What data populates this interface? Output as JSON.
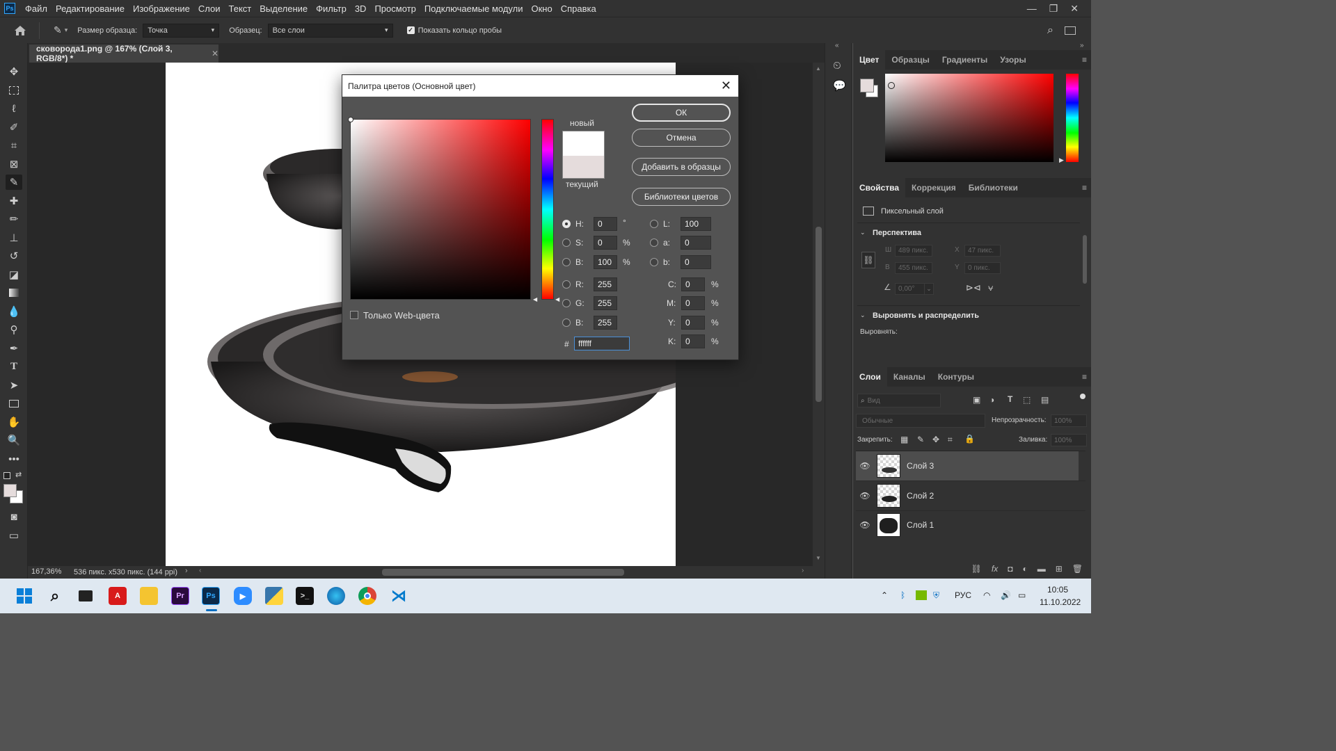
{
  "app": {
    "logo": "Ps",
    "menu": [
      "Файл",
      "Редактирование",
      "Изображение",
      "Слои",
      "Текст",
      "Выделение",
      "Фильтр",
      "3D",
      "Просмотр",
      "Подключаемые модули",
      "Окно",
      "Справка"
    ]
  },
  "options": {
    "sample_size_label": "Размер образца:",
    "sample_size_value": "Точка",
    "sample_label": "Образец:",
    "sample_value": "Все слои",
    "show_ring_label": "Показать кольцо пробы",
    "show_ring_checked": true
  },
  "document": {
    "tab_title": "сковорода1.png @ 167% (Слой 3, RGB/8*) *",
    "zoom": "167,36%",
    "doc_info": "536 пикс. x530 пикс. (144 ppi)"
  },
  "dialog": {
    "title": "Палитра цветов (Основной цвет)",
    "ok": "ОК",
    "cancel": "Отмена",
    "add_swatches": "Добавить в образцы",
    "color_libraries": "Библиотеки цветов",
    "new_label": "новый",
    "current_label": "текущий",
    "new_color": "#ffffff",
    "current_color": "#e5dcdc",
    "web_only_label": "Только Web-цвета",
    "fields": {
      "H": {
        "label": "H:",
        "value": "0",
        "unit": "°",
        "selected": true
      },
      "S": {
        "label": "S:",
        "value": "0",
        "unit": "%"
      },
      "Bh": {
        "label": "B:",
        "value": "100",
        "unit": "%"
      },
      "R": {
        "label": "R:",
        "value": "255"
      },
      "G": {
        "label": "G:",
        "value": "255"
      },
      "Bb": {
        "label": "B:",
        "value": "255"
      },
      "L": {
        "label": "L:",
        "value": "100"
      },
      "a": {
        "label": "a:",
        "value": "0"
      },
      "b": {
        "label": "b:",
        "value": "0"
      },
      "C": {
        "label": "C:",
        "value": "0",
        "unit": "%"
      },
      "M": {
        "label": "M:",
        "value": "0",
        "unit": "%"
      },
      "Y": {
        "label": "Y:",
        "value": "0",
        "unit": "%"
      },
      "K": {
        "label": "K:",
        "value": "0",
        "unit": "%"
      }
    },
    "hex_label": "#",
    "hex_value": "ffffff"
  },
  "color_panel": {
    "tabs": [
      "Цвет",
      "Образцы",
      "Градиенты",
      "Узоры"
    ]
  },
  "properties_panel": {
    "tabs": [
      "Свойства",
      "Коррекция",
      "Библиотеки"
    ],
    "layer_type": "Пиксельный слой",
    "section_perspective": "Перспектива",
    "w_label": "Ш",
    "w_value": "489 пикс.",
    "x_label": "X",
    "x_value": "47 пикс.",
    "h_label": "В",
    "h_value": "455 пикс.",
    "y_label": "Y",
    "y_value": "0 пикс.",
    "angle_value": "0,00°",
    "section_align": "Выровнять и распределить",
    "align_label": "Выровнять:"
  },
  "layers_panel": {
    "tabs": [
      "Слои",
      "Каналы",
      "Контуры"
    ],
    "search_placeholder": "Вид",
    "blend_mode": "Обычные",
    "opacity_label": "Непрозрачность:",
    "opacity_value": "100%",
    "lock_label": "Закрепить:",
    "fill_label": "Заливка:",
    "fill_value": "100%",
    "layers": [
      {
        "name": "Слой 3",
        "active": true
      },
      {
        "name": "Слой 2",
        "active": false
      },
      {
        "name": "Слой 1",
        "active": false
      }
    ]
  },
  "taskbar": {
    "lang": "РУС",
    "time": "10:05",
    "date": "11.10.2022"
  }
}
